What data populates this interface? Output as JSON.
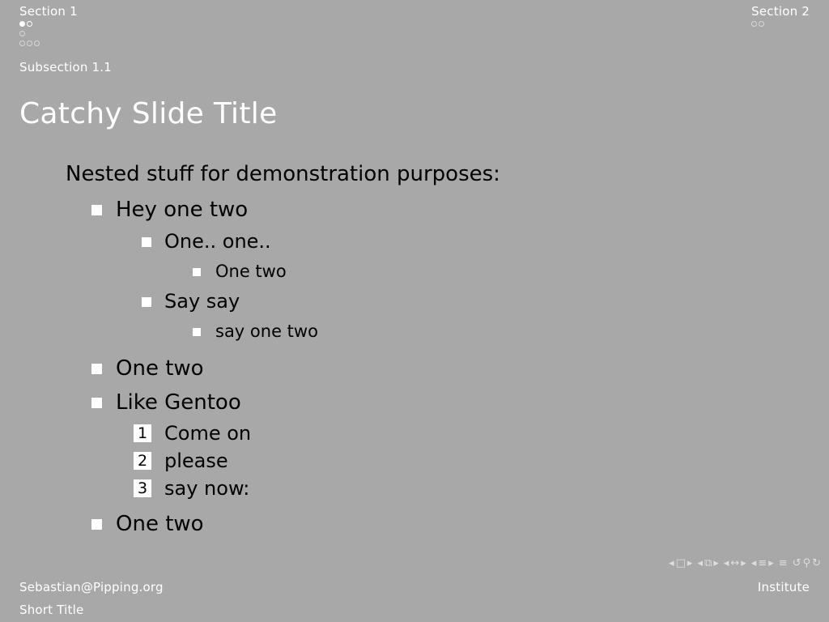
{
  "header": {
    "sections": [
      {
        "title": "Section 1",
        "dot_rows": [
          [
            "filled",
            "open"
          ],
          [
            "faint"
          ],
          [
            "faint",
            "faint",
            "faint"
          ]
        ]
      },
      {
        "title": "Section 2",
        "dot_rows": [
          [
            "faint",
            "faint"
          ]
        ]
      }
    ],
    "subsection": "Subsection 1.1"
  },
  "slide": {
    "title": "Catchy Slide Title",
    "intro": "Nested stuff for demonstration purposes:",
    "items": {
      "i1": "Hey one two",
      "i1_1": "One.. one..",
      "i1_1_1": "One two",
      "i1_2": "Say say",
      "i1_2_1": "say one two",
      "i2": "One two",
      "i3": "Like Gentoo",
      "i3_1_num": "1",
      "i3_1": "Come on",
      "i3_2_num": "2",
      "i3_2": "please",
      "i3_3_num": "3",
      "i3_3": "say now:",
      "i4": "One two"
    }
  },
  "nav_symbols": {
    "prev": "◂",
    "next": "▸",
    "frame": "□",
    "subsection": "⧉",
    "section": "↔",
    "presentation": "≡",
    "toc": "≡",
    "undo": "↺",
    "search": "⚲",
    "redo": "↻"
  },
  "footer": {
    "author": "Sebastian@Pipping.org",
    "short_title": "Short Title",
    "institute": "Institute"
  },
  "colors": {
    "background": "#a8a8a8",
    "accent_text": "#ffffff",
    "body_text": "#000000",
    "nav_symbols": "#dedede"
  }
}
